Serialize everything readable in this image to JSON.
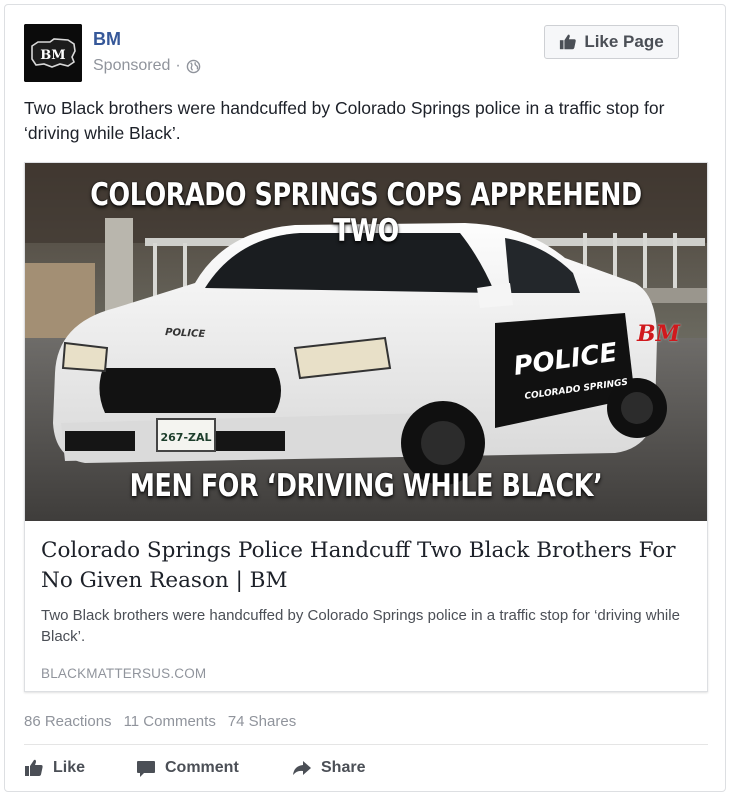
{
  "post": {
    "page_name": "BM",
    "avatar_text": "BM",
    "sponsored_label": "Sponsored",
    "separator": "·",
    "globe_icon": "globe-icon",
    "like_page_label": "Like Page",
    "text": "Two Black brothers were handcuffed by Colorado Springs police in a traffic stop for ‘driving while Black’."
  },
  "link": {
    "image_top_text": "COLORADO SPRINGS COPS APPREHEND TWO",
    "image_bottom_text": "MEN FOR ‘DRIVING WHILE BLACK’",
    "image_car_text": "POLICE",
    "image_car_subtext": "COLORADO SPRINGS",
    "image_plate": "267-ZAL",
    "image_watermark": "BM",
    "title": "Colorado Springs Police Handcuff Two Black Brothers For No Given Reason | BM",
    "description": "Two Black brothers were handcuffed by Colorado Springs police in a traffic stop for ‘driving while Black’.",
    "domain": "BLACKMATTERSUS.COM"
  },
  "stats": {
    "reactions": "86 Reactions",
    "comments": "11 Comments",
    "shares": "74 Shares"
  },
  "actions": {
    "like": "Like",
    "comment": "Comment",
    "share": "Share"
  },
  "colors": {
    "link_blue": "#365899",
    "muted_gray": "#90949c",
    "action_gray": "#4b4f56",
    "watermark_red": "#d0191d"
  }
}
